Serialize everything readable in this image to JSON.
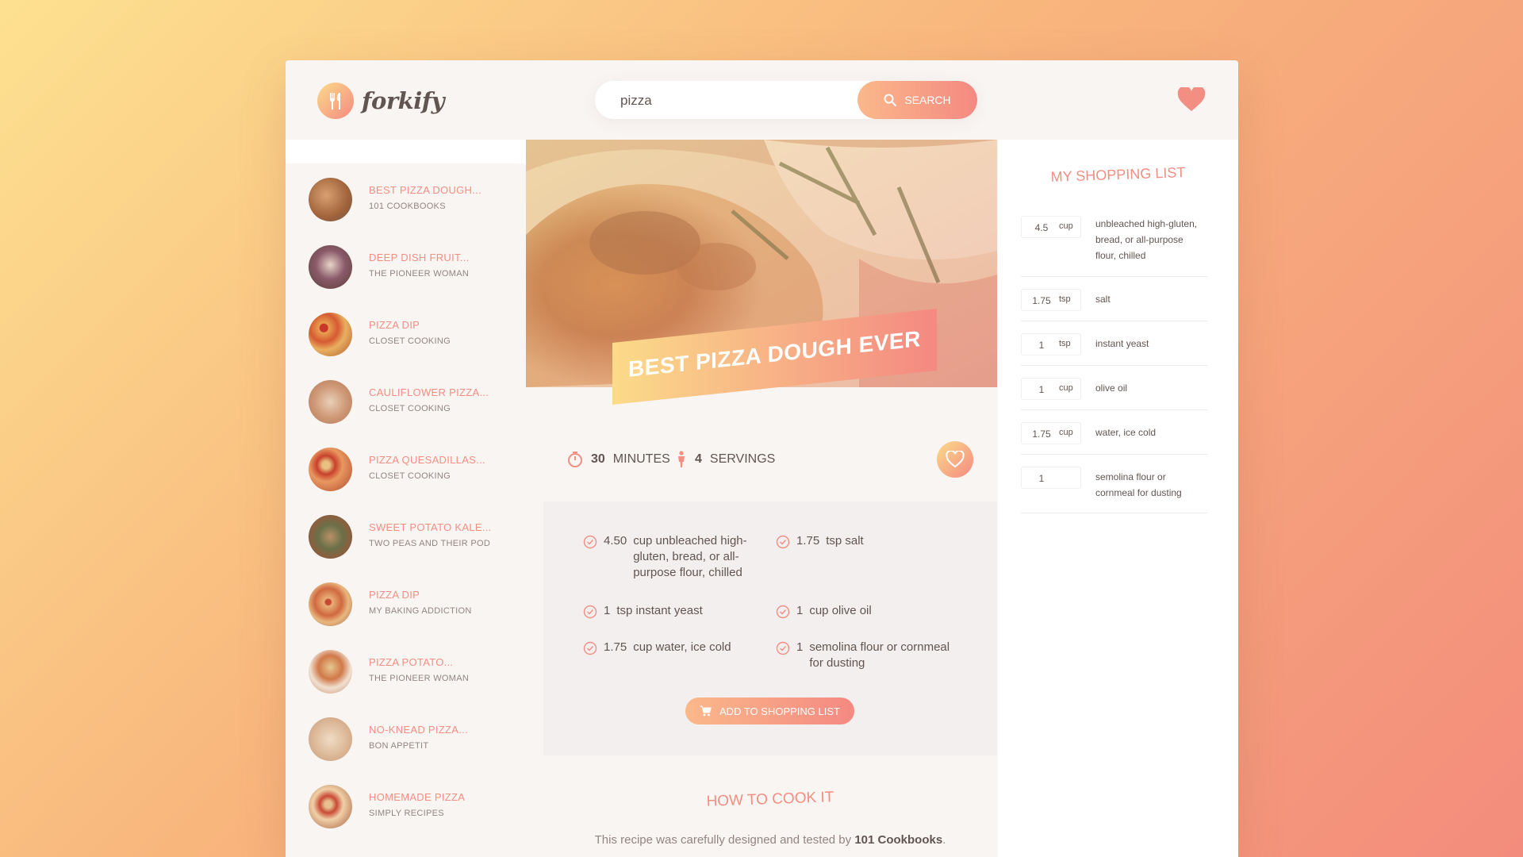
{
  "header": {
    "logo_text": "forkify",
    "search": {
      "value": "pizza",
      "button_label": "SEARCH"
    }
  },
  "results": [
    {
      "title": "BEST PIZZA DOUGH...",
      "publisher": "101 COOKBOOKS"
    },
    {
      "title": "DEEP DISH FRUIT...",
      "publisher": "THE PIONEER WOMAN"
    },
    {
      "title": "PIZZA DIP",
      "publisher": "CLOSET COOKING"
    },
    {
      "title": "CAULIFLOWER PIZZA...",
      "publisher": "CLOSET COOKING"
    },
    {
      "title": "PIZZA QUESADILLAS...",
      "publisher": "CLOSET COOKING"
    },
    {
      "title": "SWEET POTATO KALE...",
      "publisher": "TWO PEAS AND THEIR POD"
    },
    {
      "title": "PIZZA DIP",
      "publisher": "MY BAKING ADDICTION"
    },
    {
      "title": "PIZZA POTATO...",
      "publisher": "THE PIONEER WOMAN"
    },
    {
      "title": "NO-KNEAD PIZZA...",
      "publisher": "BON APPETIT"
    },
    {
      "title": "HOMEMADE PIZZA",
      "publisher": "SIMPLY RECIPES"
    }
  ],
  "recipe": {
    "title": "BEST PIZZA DOUGH EVER",
    "minutes": "30",
    "minutes_label": "MINUTES",
    "servings": "4",
    "servings_label": "SERVINGS",
    "ingredients": [
      {
        "qty": "4.50",
        "text": "cup unbleached high-gluten, bread, or all-purpose flour, chilled"
      },
      {
        "qty": "1.75",
        "text": "tsp salt"
      },
      {
        "qty": "1",
        "text": "tsp instant yeast"
      },
      {
        "qty": "1",
        "text": "cup olive oil"
      },
      {
        "qty": "1.75",
        "text": "cup water, ice cold"
      },
      {
        "qty": "1",
        "text": "semolina flour or cornmeal for dusting"
      }
    ],
    "add_button_label": "ADD TO SHOPPING LIST",
    "howto_title": "HOW TO COOK IT",
    "howto_text_before": "This recipe was carefully designed and tested by ",
    "howto_publisher": "101 Cookbooks",
    "howto_text_after": "."
  },
  "shopping": {
    "title": "MY SHOPPING LIST",
    "items": [
      {
        "count": "4.5",
        "unit": "cup",
        "desc": "unbleached high-gluten, bread, or all-purpose flour, chilled"
      },
      {
        "count": "1.75",
        "unit": "tsp",
        "desc": "salt"
      },
      {
        "count": "1",
        "unit": "tsp",
        "desc": "instant yeast"
      },
      {
        "count": "1",
        "unit": "cup",
        "desc": "olive oil"
      },
      {
        "count": "1.75",
        "unit": "cup",
        "desc": "water, ice cold"
      },
      {
        "count": "1",
        "unit": "",
        "desc": "semolina flour or cornmeal for dusting"
      }
    ]
  },
  "colors": {
    "accent": "#f38e82",
    "gradient_start": "#fbdb89",
    "gradient_end": "#f48982",
    "text": "#615551"
  }
}
